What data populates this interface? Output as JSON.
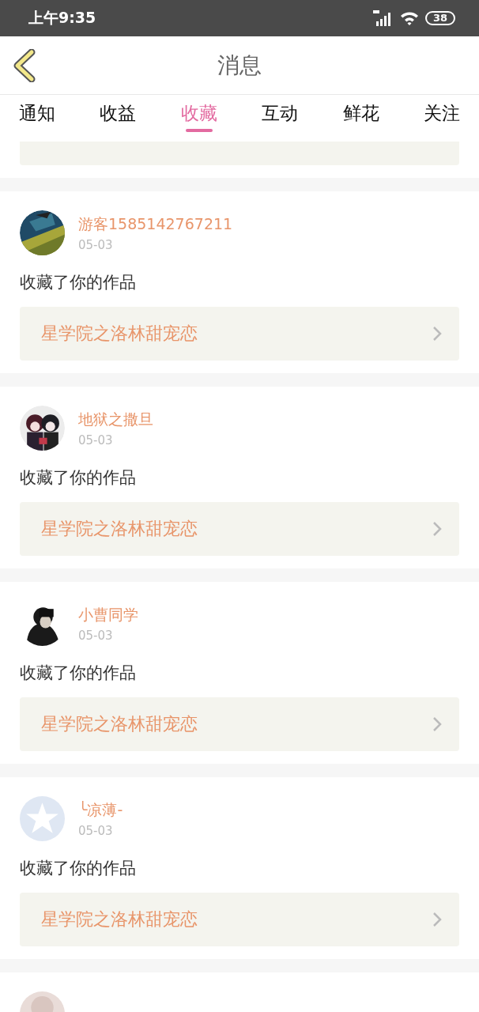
{
  "status_bar": {
    "time": "上午9:35",
    "battery": "38"
  },
  "header": {
    "title": "消息"
  },
  "tabs": [
    {
      "label": "通知",
      "selected": false
    },
    {
      "label": "收益",
      "selected": false
    },
    {
      "label": "收藏",
      "selected": true
    },
    {
      "label": "互动",
      "selected": false
    },
    {
      "label": "鲜花",
      "selected": false
    },
    {
      "label": "关注",
      "selected": false
    }
  ],
  "messages": [
    {
      "name": "游客1585142767211",
      "date": "05-03",
      "text": "收藏了你的作品",
      "work": "星学院之洛林甜宠恋"
    },
    {
      "name": "地狱之撒旦",
      "date": "05-03",
      "text": "收藏了你的作品",
      "work": "星学院之洛林甜宠恋"
    },
    {
      "name": "小曹同学",
      "date": "05-03",
      "text": "收藏了你的作品",
      "work": "星学院之洛林甜宠恋"
    },
    {
      "avatar": {
        "kind": "icon"
      },
      "name": "╰凉薄-",
      "date": "05-03",
      "text": "收藏了你的作品",
      "work": "星学院之洛林甜宠恋"
    }
  ]
}
